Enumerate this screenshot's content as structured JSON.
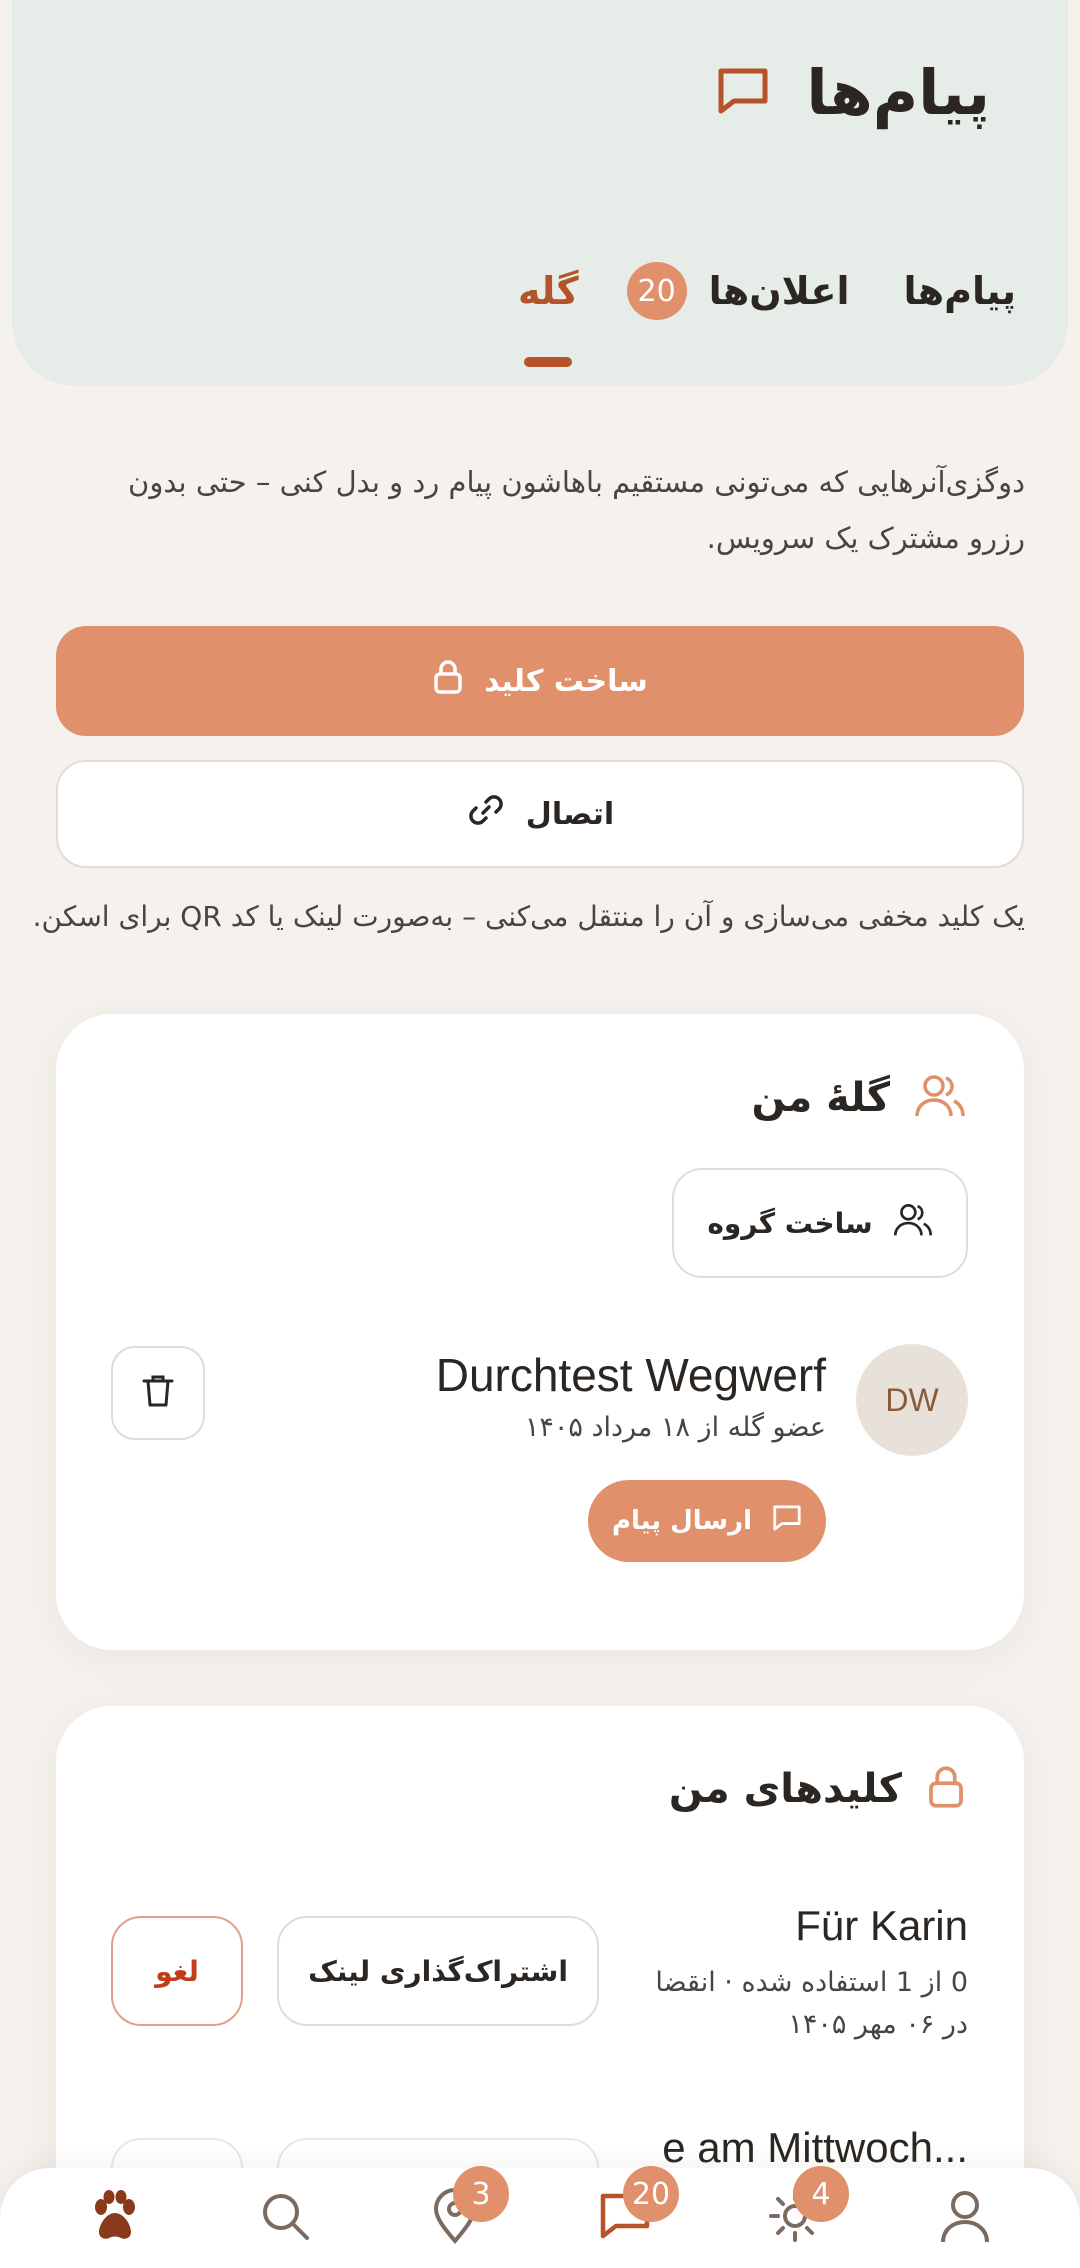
{
  "header": {
    "title": "پیام‌ها",
    "tabs": [
      {
        "label": "پیام‌ها"
      },
      {
        "label": "اعلان‌ها",
        "badge": "20"
      },
      {
        "label": "گله"
      }
    ]
  },
  "intro_text": "دوگزی‌آنرهایی که می‌تونی مستقیم باهاشون پیام رد و بدل کنی – حتی بدون رزرو مشترک یک سرویس.",
  "actions": {
    "create_key_label": "ساخت کلید",
    "connect_label": "اتصال",
    "hint": "یک کلید مخفی می‌سازی و آن را منتقل می‌کنی – به‌صورت لینک یا کد QR برای اسکن."
  },
  "pack": {
    "title": "گلهٔ من",
    "create_group_label": "ساخت گروه",
    "member": {
      "initials": "DW",
      "name": "Durchtest Wegwerf",
      "since": "عضو گله از ۱۸ مرداد ۱۴۰۵",
      "send_message_label": "ارسال پیام"
    }
  },
  "keys": {
    "title": "کلیدهای من",
    "items": [
      {
        "name": "Für Karin",
        "meta": "0 از 1 استفاده شده · انقضا در ۰۶ مهر ۱۴۰۵",
        "share_label": "اشتراک‌گذاری لینک",
        "revoke_label": "لغو"
      },
      {
        "name": "...e am Mittwoch"
      }
    ]
  },
  "nav": {
    "items": [
      {
        "icon": "paw-icon"
      },
      {
        "icon": "search-icon"
      },
      {
        "icon": "location-pin-icon",
        "badge": "3"
      },
      {
        "icon": "message-icon",
        "badge": "20"
      },
      {
        "icon": "sun-icon",
        "badge": "4"
      },
      {
        "icon": "profile-icon"
      }
    ]
  },
  "colors": {
    "accent": "#e0906a",
    "accent_dark": "#b5532a",
    "header_bg": "#e6ece7",
    "page_bg": "#f5f1ed",
    "danger": "#c23b1a"
  }
}
